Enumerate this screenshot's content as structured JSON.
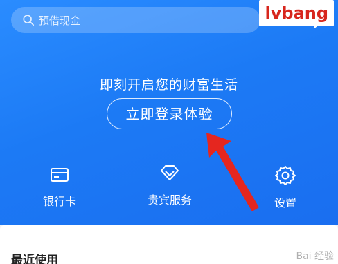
{
  "search": {
    "placeholder": "预借现金"
  },
  "header": {
    "watermark": "lvbang"
  },
  "hero": {
    "slogan": "即刻开启您的财富生活",
    "login_button": "立即登录体验"
  },
  "shortcuts": [
    {
      "label": "银行卡",
      "icon": "bank-card-icon"
    },
    {
      "label": "贵宾服务",
      "icon": "diamond-icon"
    },
    {
      "label": "设置",
      "icon": "gear-icon"
    }
  ],
  "recent": {
    "title": "最近使用"
  },
  "footer": {
    "watermark": "Bai 经验"
  },
  "colors": {
    "hero_blue": "#1c7af5",
    "arrow_red": "#e5261f",
    "brand_red": "#d7261d"
  }
}
